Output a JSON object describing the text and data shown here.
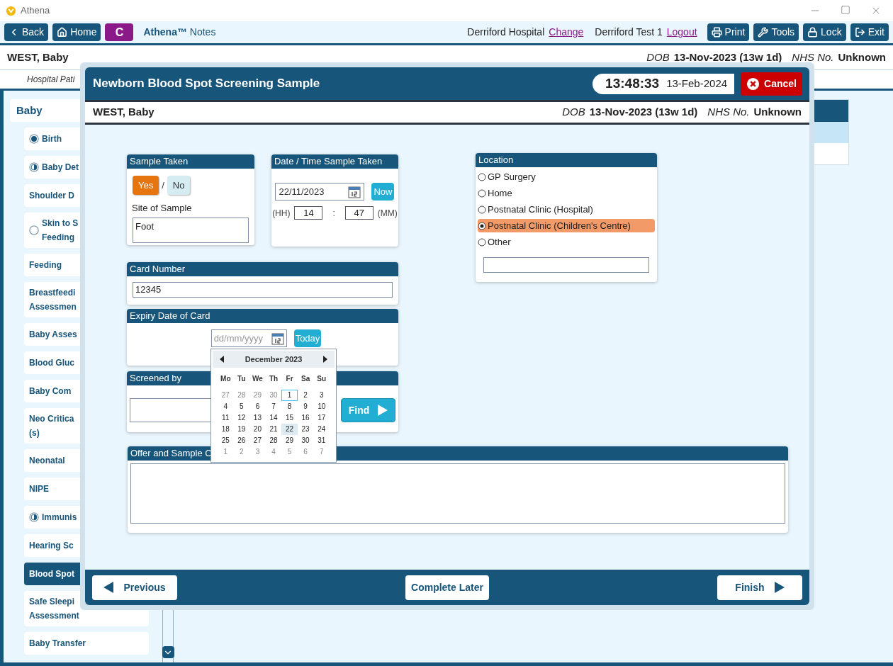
{
  "window": {
    "title": "Athena"
  },
  "toolbar": {
    "left_buttons": [
      {
        "kind": "back",
        "label": "Back"
      },
      {
        "kind": "home",
        "label": "Home"
      }
    ],
    "badge": "C",
    "app_name": "**Athena™** Notes",
    "hospital": "Derriford Hospital",
    "change_link": "Change",
    "user": "Derriford Test 1",
    "logout_link": "Logout",
    "right_buttons": [
      {
        "kind": "print",
        "label": "Print"
      },
      {
        "kind": "tools",
        "label": "Tools"
      },
      {
        "kind": "lock",
        "label": "Lock"
      },
      {
        "kind": "exit",
        "label": "Exit"
      }
    ]
  },
  "patient_banner": {
    "name": "WEST, Baby",
    "dob_label": "DOB",
    "dob": "13-Nov-2023 (13w 1d)",
    "nhs_label": "NHS No.",
    "nhs": "Unknown"
  },
  "sub_bar": "Hospital Pati",
  "sidebar": {
    "header": "Baby",
    "items": [
      {
        "label": "Birth",
        "kind": "filled",
        "selected": false
      },
      {
        "label": "Baby Det",
        "kind": "half",
        "selected": false
      },
      {
        "label": "Shoulder D",
        "selected": false
      },
      {
        "label": "Skin to S\nFeeding",
        "kind": "empty",
        "selected": false
      },
      {
        "label": "Feeding",
        "selected": false
      },
      {
        "label": "Breastfeedi\nAssessmen",
        "selected": false
      },
      {
        "label": "Baby Asses",
        "selected": false
      },
      {
        "label": "Blood Gluc",
        "selected": false
      },
      {
        "label": "Baby Com",
        "selected": false
      },
      {
        "label": "Neo Critica\n(s)",
        "selected": false
      },
      {
        "label": "Neonatal",
        "selected": false
      },
      {
        "label": "NIPE",
        "selected": false
      },
      {
        "label": "Immunis",
        "kind": "half",
        "selected": false
      },
      {
        "label": "Hearing Sc",
        "selected": false
      },
      {
        "label": "Blood Spot",
        "selected": true
      },
      {
        "label": "Safe Sleepi\nAssessment",
        "selected": false
      },
      {
        "label": "Baby Transfer",
        "selected": false
      }
    ]
  },
  "dialog": {
    "title": "Newborn Blood Spot Screening Sample",
    "time": "13:48:33",
    "date": "13-Feb-2024",
    "cancel": "Cancel",
    "patient": {
      "name": "WEST, Baby",
      "dob_label": "DOB",
      "dob": "13-Nov-2023 (13w 1d)",
      "nhs_label": "NHS No.",
      "nhs": "Unknown"
    },
    "sample_taken": {
      "title": "Sample Taken",
      "options": [
        {
          "label": "Yes",
          "selected": true
        },
        {
          "label": "No",
          "selected": false
        }
      ],
      "separator": "/",
      "site_label": "Site of Sample",
      "site_value": "Foot"
    },
    "date_time": {
      "title": "Date / Time Sample Taken",
      "date": "22/11/2023",
      "now": "Now",
      "hh_label": "(HH)",
      "hh": "14",
      "separator": ":",
      "mm": "47",
      "mm_label": "(MM)"
    },
    "location": {
      "title": "Location",
      "options": [
        {
          "label": "GP Surgery",
          "selected": false
        },
        {
          "label": "Home",
          "selected": false
        },
        {
          "label": "Postnatal Clinic (Hospital)",
          "selected": false
        },
        {
          "label": "Postnatal Clinic (Children's Centre)",
          "selected": true
        },
        {
          "label": "Other",
          "selected": false
        }
      ]
    },
    "card_number": {
      "title": "Card Number",
      "value": "12345"
    },
    "expiry": {
      "title": "Expiry Date of Card",
      "placeholder": "dd/mm/yyyy",
      "today": "Today"
    },
    "calendar": {
      "month": "December 2023",
      "weekdays": [
        "Mo",
        "Tu",
        "We",
        "Th",
        "Fr",
        "Sa",
        "Su"
      ],
      "weeks": [
        [
          {
            "label": "27",
            "outside": true
          },
          {
            "label": "28",
            "outside": true
          },
          {
            "label": "29",
            "outside": true
          },
          {
            "label": "30",
            "outside": true
          },
          {
            "label": "1",
            "focused": true
          },
          {
            "label": "2"
          },
          {
            "label": "3"
          }
        ],
        [
          {
            "label": "4"
          },
          {
            "label": "5"
          },
          {
            "label": "6"
          },
          {
            "label": "7"
          },
          {
            "label": "8"
          },
          {
            "label": "9"
          },
          {
            "label": "10"
          }
        ],
        [
          {
            "label": "11"
          },
          {
            "label": "12"
          },
          {
            "label": "13"
          },
          {
            "label": "14"
          },
          {
            "label": "15"
          },
          {
            "label": "16"
          },
          {
            "label": "17"
          }
        ],
        [
          {
            "label": "18"
          },
          {
            "label": "19"
          },
          {
            "label": "20"
          },
          {
            "label": "21"
          },
          {
            "label": "22",
            "selected": true
          },
          {
            "label": "23"
          },
          {
            "label": "24"
          }
        ],
        [
          {
            "label": "25"
          },
          {
            "label": "26"
          },
          {
            "label": "27"
          },
          {
            "label": "28"
          },
          {
            "label": "29"
          },
          {
            "label": "30"
          },
          {
            "label": "31"
          }
        ],
        [
          {
            "label": "1",
            "outside": true
          },
          {
            "label": "2",
            "outside": true
          },
          {
            "label": "3",
            "outside": true
          },
          {
            "label": "4",
            "outside": true
          },
          {
            "label": "5",
            "outside": true
          },
          {
            "label": "6",
            "outside": true
          },
          {
            "label": "7",
            "outside": true
          }
        ]
      ]
    },
    "screened_by": {
      "title": "Screened by",
      "find": "Find"
    },
    "offer": {
      "title": "Offer and Sample C"
    },
    "footer": {
      "previous": "Previous",
      "complete_later": "Complete Later",
      "finish": "Finish"
    }
  }
}
